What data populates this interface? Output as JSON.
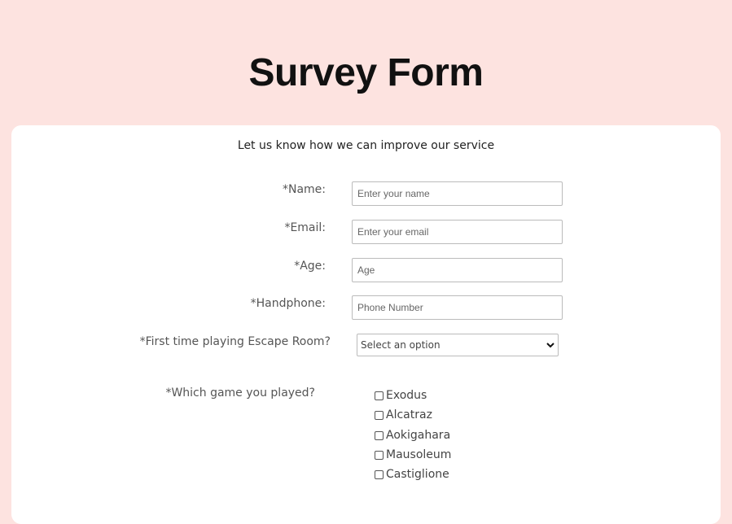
{
  "title": "Survey Form",
  "subtitle": "Let us know how we can improve our service",
  "fields": [
    {
      "label": "*Name:",
      "placeholder": "Enter your name"
    },
    {
      "label": "*Email:",
      "placeholder": "Enter your email"
    },
    {
      "label": "*Age:",
      "placeholder": "Age"
    },
    {
      "label": "*Handphone:",
      "placeholder": "Phone Number"
    }
  ],
  "first_time": {
    "label": "*First time playing Escape Room?",
    "selected": "Select an option"
  },
  "games": {
    "label": "*Which game you played?",
    "options": [
      "Exodus",
      "Alcatraz",
      "Aokigahara",
      "Mausoleum",
      "Castiglione"
    ]
  }
}
